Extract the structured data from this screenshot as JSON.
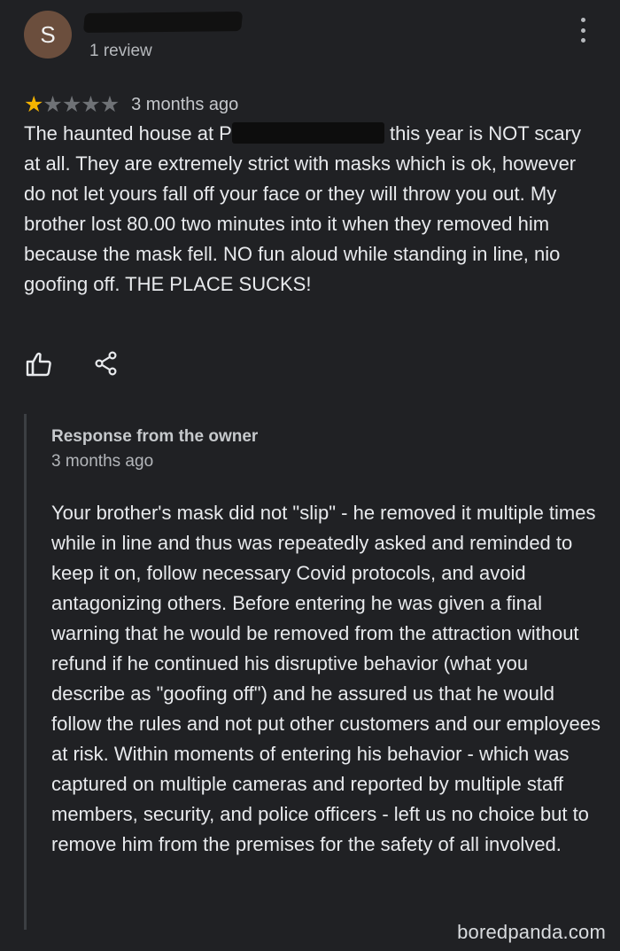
{
  "reviewer": {
    "avatar_letter": "S",
    "avatar_color": "#6b4e3d",
    "review_count": "1 review",
    "menu_icon": "kebab-menu-icon"
  },
  "review": {
    "rating": 1,
    "max_rating": 5,
    "star_on_color": "#f5b400",
    "star_off_color": "#6f7276",
    "time_ago": "3 months ago",
    "text_before_redaction": "The haunted house at P",
    "text_after_redaction": "this year is NOT scary at all.  They are extremely strict with masks which is ok, however do not let yours fall off your face or they will throw you out.  My brother lost 80.00 two minutes into it when they removed him because the mask fell.  NO fun aloud while standing in line, nio goofing off.  THE PLACE SUCKS!"
  },
  "actions": {
    "like_icon": "thumbs-up-icon",
    "share_icon": "share-icon"
  },
  "owner_response": {
    "label": "Response from the owner",
    "time_ago": "3 months ago",
    "text": "Your brother's mask did not \"slip\" - he removed it multiple times while in line and thus was repeatedly asked and reminded to keep it on, follow necessary Covid protocols, and avoid antagonizing others. Before entering he was given a final warning that he would be removed from the attraction without refund if he continued his disruptive behavior (what you describe as \"goofing off\") and he assured us that he would follow the rules and not put other customers and our employees at risk. Within moments of entering his behavior - which was captured on multiple cameras and reported by multiple staff members, security, and police officers - left us no choice but to remove him from the premises for the safety of all involved."
  },
  "watermark": "boredpanda.com",
  "colors": {
    "background": "#202124",
    "text": "#e8eaed",
    "secondary_text": "#b6b9bd",
    "response_rule": "#3c3f43"
  }
}
